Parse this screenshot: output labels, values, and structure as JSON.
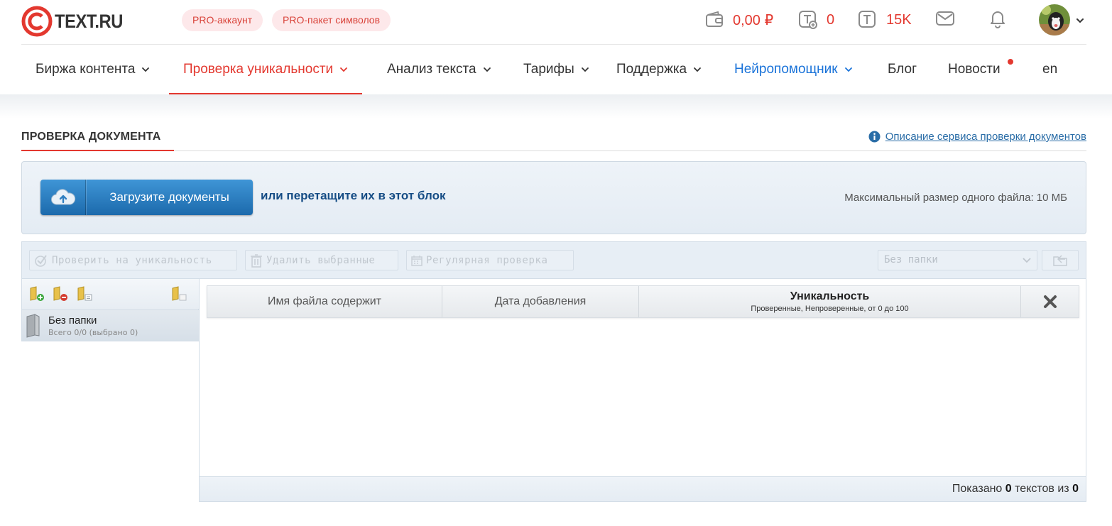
{
  "header": {
    "logo_text": "TEXT.RU",
    "pro_account": "PRO-аккаунт",
    "pro_package": "PRO-пакет символов",
    "balance": "0,00 ₽",
    "tokens": "0",
    "symbols": "15K",
    "icons": [
      "wallet-icon",
      "token-plus-icon",
      "token-icon",
      "mail-icon",
      "bell-icon",
      "avatar",
      "chevron-down-icon"
    ]
  },
  "nav": {
    "items": [
      {
        "label": "Биржа контента"
      },
      {
        "label": "Проверка уникальности"
      },
      {
        "label": "Анализ текста"
      },
      {
        "label": "Тарифы"
      },
      {
        "label": "Поддержка"
      },
      {
        "label": "Нейропомощник"
      },
      {
        "label": "Блог"
      },
      {
        "label": "Новости"
      },
      {
        "label": "en"
      }
    ],
    "active_index": 1
  },
  "section": {
    "title": "ПРОВЕРКА ДОКУМЕНТА",
    "info_link": "Описание сервиса проверки документов"
  },
  "upload": {
    "button_label": "Загрузите документы",
    "drop_text": "или перетащите их в этот блок",
    "max_size": "Максимальный размер одного файла: 10 МБ"
  },
  "toolbar": {
    "check": "Проверить на уникальность",
    "delete": "Удалить выбранные",
    "regular": "Регулярная проверка",
    "folder_select": "Без папки"
  },
  "folders": {
    "items": [
      {
        "name": "Без папки",
        "sub": "Всего 0/0 (выбрано 0)"
      }
    ]
  },
  "table": {
    "columns": {
      "filename": "Имя файла содержит",
      "date": "Дата добавления",
      "uniqueness": "Уникальность",
      "uniqueness_sub": "Проверенные, Непроверенные, от 0 до 100"
    },
    "footer": {
      "shown_label": "Показано",
      "shown": "0",
      "of_label": "текстов из",
      "total": "0"
    }
  },
  "colors": {
    "accent": "#e3382f",
    "link": "#2a6da7",
    "neuro": "#1a73d9",
    "upload_button": "#2a7fc4"
  }
}
